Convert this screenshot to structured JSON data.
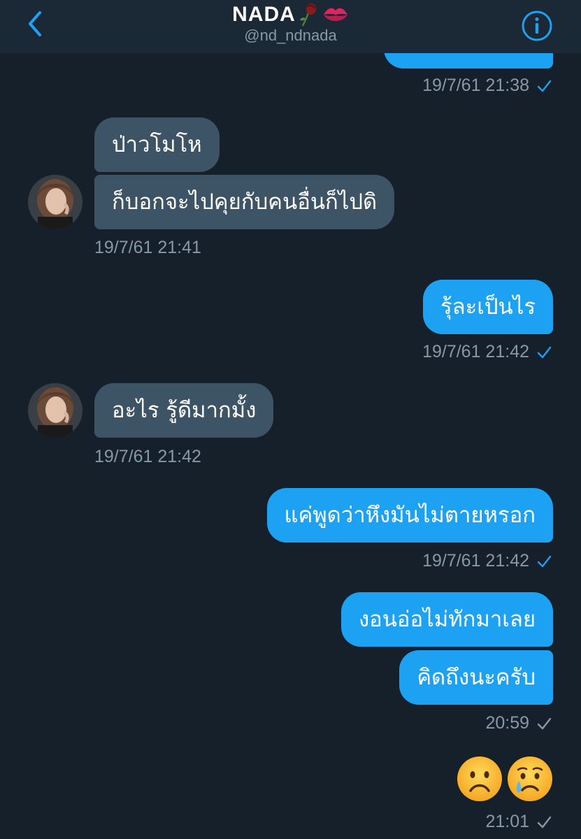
{
  "header": {
    "title": "NADA",
    "title_emoji": [
      "wilted-rose-emoji",
      "kiss-mark-emoji"
    ],
    "handle": "@nd_ndnada",
    "back_icon": "chevron-left-icon",
    "info_icon": "info-icon"
  },
  "colors": {
    "background": "#15202b",
    "header": "#1b2836",
    "incoming_bubble": "#3d5466",
    "outgoing_bubble": "#1da1f2",
    "accent": "#1da1f2",
    "muted_text": "#8899a6"
  },
  "messages": [
    {
      "sender": "me",
      "text": "",
      "timestamp": "19/7/61 21:38",
      "read": true
    },
    {
      "sender": "them",
      "text": "ป่าวโมโห"
    },
    {
      "sender": "them",
      "text": "ก็บอกจะไปคุยกับคนอื่นก็ไปดิ",
      "timestamp": "19/7/61 21:41"
    },
    {
      "sender": "me",
      "text": "รุ้ละเป็นไร",
      "timestamp": "19/7/61 21:42",
      "read": true
    },
    {
      "sender": "them",
      "text": "อะไร รู้ดีมากมั้ง",
      "timestamp": "19/7/61 21:42"
    },
    {
      "sender": "me",
      "text": "แค่พูดว่าหึงมันไม่ตายหรอก",
      "timestamp": "19/7/61 21:42",
      "read": true
    },
    {
      "sender": "me",
      "text": "งอนอ่อไม่ทักมาเลย"
    },
    {
      "sender": "me",
      "text": "คิดถึงนะครับ",
      "timestamp": "20:59",
      "read": false
    },
    {
      "sender": "me",
      "emoji": [
        "frowning-face-emoji",
        "crying-face-emoji"
      ],
      "timestamp": "21:01",
      "read": false
    }
  ]
}
